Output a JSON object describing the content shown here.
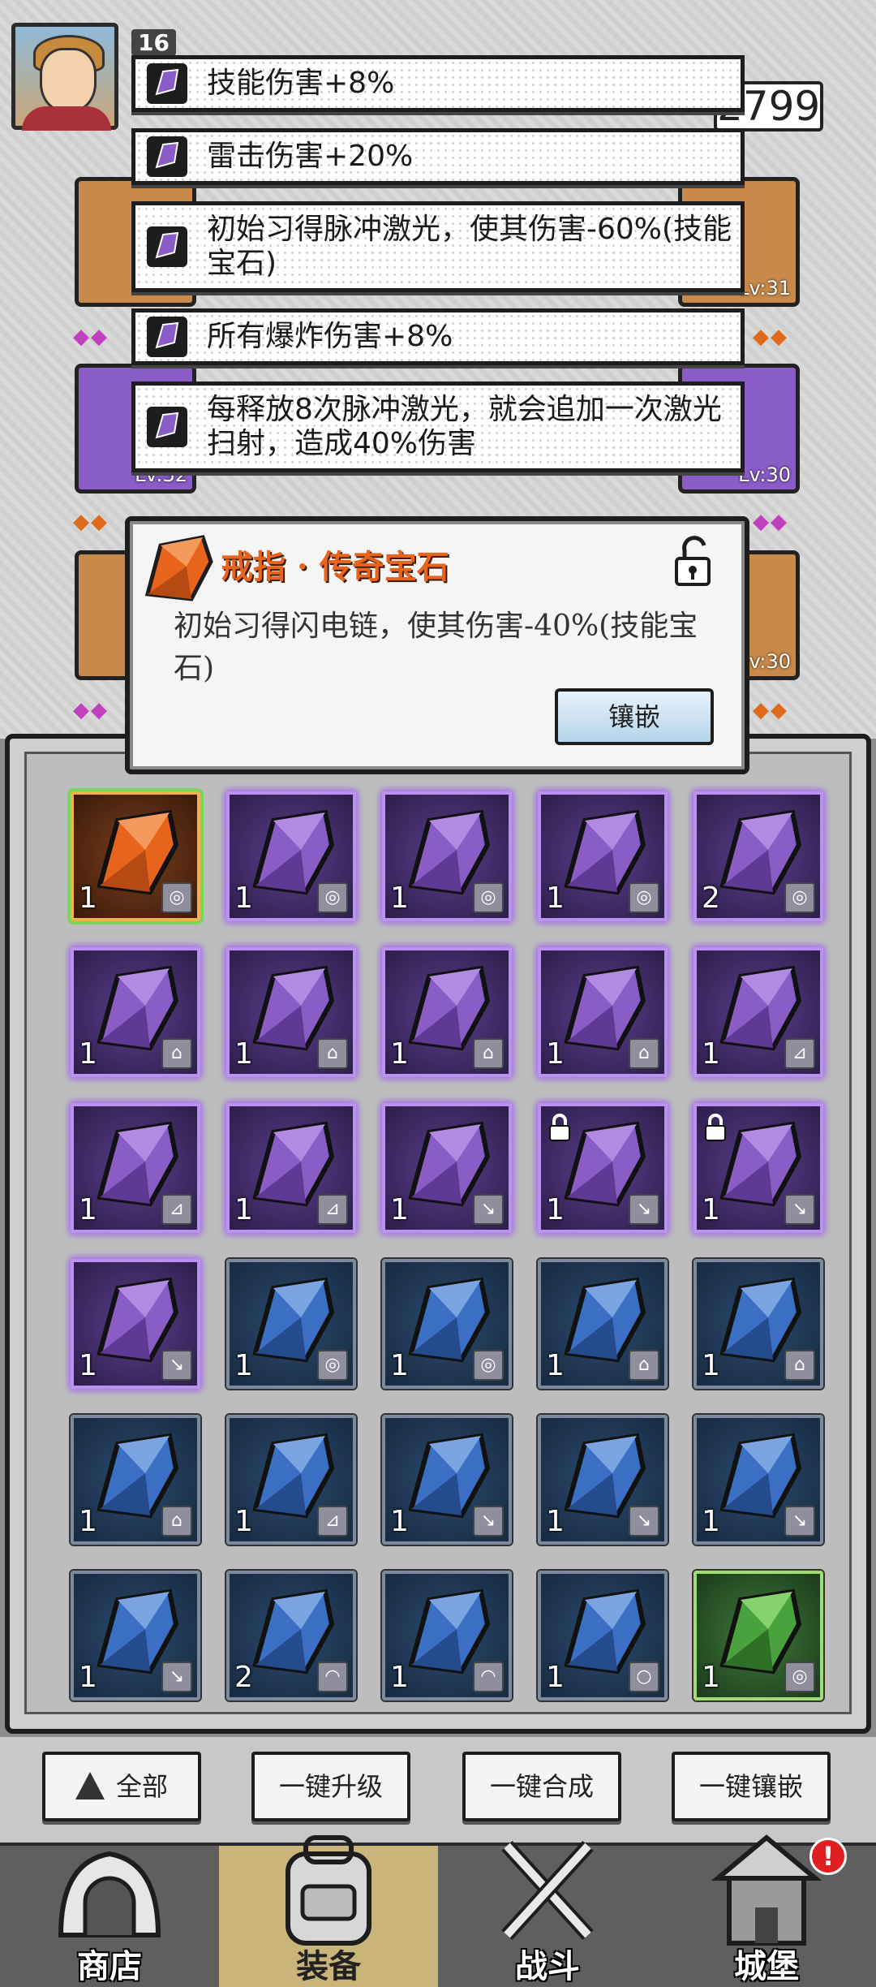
{
  "header": {
    "level": "16",
    "power": "2799"
  },
  "equip_levels": {
    "slot_right_top": "Lv:31",
    "slot_right_mid": "Lv:30",
    "slot_right_bot": ":v:30",
    "slot_left_mid": "Lv:32"
  },
  "skills": [
    {
      "text": "技能伤害+8%"
    },
    {
      "text": "雷击伤害+20%"
    },
    {
      "text": "初始习得脉冲激光，使其伤害-60%(技能宝石)"
    },
    {
      "text": "所有爆炸伤害+8%"
    },
    {
      "text": "每释放8次脉冲激光，就会追加一次激光扫射，造成40%伤害"
    }
  ],
  "tooltip": {
    "title": "戒指 · 传奇宝石",
    "description": "初始习得闪电链，使其伤害-40%(技能宝石)",
    "inlay_button": "镶嵌"
  },
  "inventory": [
    {
      "color": "orange",
      "count": "1",
      "slot": "ring",
      "locked": false
    },
    {
      "color": "purple",
      "count": "1",
      "slot": "ring",
      "locked": false
    },
    {
      "color": "purple",
      "count": "1",
      "slot": "ring",
      "locked": false
    },
    {
      "color": "purple",
      "count": "1",
      "slot": "ring",
      "locked": false
    },
    {
      "color": "purple",
      "count": "2",
      "slot": "ring",
      "locked": false
    },
    {
      "color": "purple",
      "count": "1",
      "slot": "armor",
      "locked": false
    },
    {
      "color": "purple",
      "count": "1",
      "slot": "armor",
      "locked": false
    },
    {
      "color": "purple",
      "count": "1",
      "slot": "armor",
      "locked": false
    },
    {
      "color": "purple",
      "count": "1",
      "slot": "armor",
      "locked": false
    },
    {
      "color": "purple",
      "count": "1",
      "slot": "boots",
      "locked": false
    },
    {
      "color": "purple",
      "count": "1",
      "slot": "boots",
      "locked": false
    },
    {
      "color": "purple",
      "count": "1",
      "slot": "boots",
      "locked": false
    },
    {
      "color": "purple",
      "count": "1",
      "slot": "weapon",
      "locked": false
    },
    {
      "color": "purple",
      "count": "1",
      "slot": "weapon",
      "locked": true
    },
    {
      "color": "purple",
      "count": "1",
      "slot": "weapon",
      "locked": true
    },
    {
      "color": "purple",
      "count": "1",
      "slot": "weapon",
      "locked": false
    },
    {
      "color": "blue",
      "count": "1",
      "slot": "ring",
      "locked": false
    },
    {
      "color": "blue",
      "count": "1",
      "slot": "ring",
      "locked": false
    },
    {
      "color": "blue",
      "count": "1",
      "slot": "armor",
      "locked": false
    },
    {
      "color": "blue",
      "count": "1",
      "slot": "armor",
      "locked": false
    },
    {
      "color": "blue",
      "count": "1",
      "slot": "armor",
      "locked": false
    },
    {
      "color": "blue",
      "count": "1",
      "slot": "boots",
      "locked": false
    },
    {
      "color": "blue",
      "count": "1",
      "slot": "weapon",
      "locked": false
    },
    {
      "color": "blue",
      "count": "1",
      "slot": "weapon",
      "locked": false
    },
    {
      "color": "blue",
      "count": "1",
      "slot": "weapon",
      "locked": false
    },
    {
      "color": "blue",
      "count": "1",
      "slot": "weapon",
      "locked": false
    },
    {
      "color": "blue",
      "count": "2",
      "slot": "helmet",
      "locked": false
    },
    {
      "color": "blue",
      "count": "1",
      "slot": "helmet",
      "locked": false
    },
    {
      "color": "blue",
      "count": "1",
      "slot": "necklace",
      "locked": false
    },
    {
      "color": "green",
      "count": "1",
      "slot": "ring",
      "locked": false
    }
  ],
  "actions": {
    "filter_all": "全部",
    "upgrade_all": "一键升级",
    "merge_all": "一键合成",
    "inlay_all": "一键镶嵌"
  },
  "nav": {
    "shop": "商店",
    "equipment": "装备",
    "battle": "战斗",
    "castle": "城堡",
    "castle_badge": "!"
  },
  "colors": {
    "legendary": "#e8641c",
    "epic": "#8a5cc6",
    "rare": "#3b6fc4",
    "uncommon": "#4aa23e"
  }
}
